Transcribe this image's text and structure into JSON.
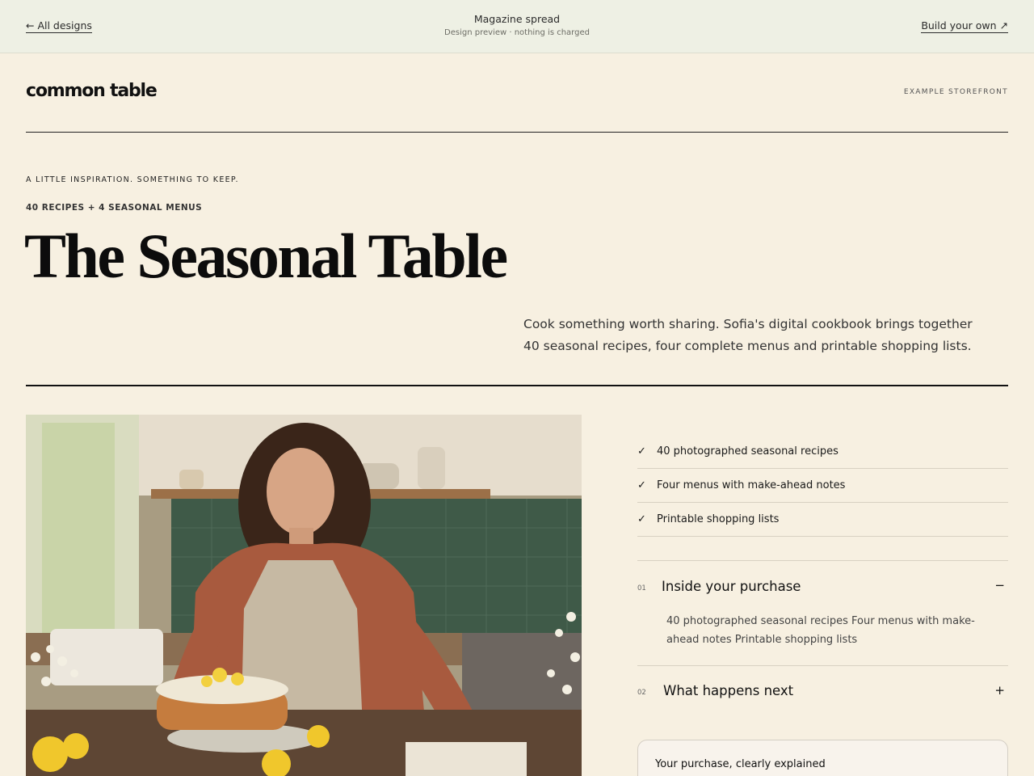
{
  "topbar": {
    "back_label": "← All designs",
    "title": "Magazine spread",
    "subtitle": "Design preview · nothing is charged",
    "build_label": "Build your own ↗"
  },
  "brand": {
    "name": "common table",
    "storefront_label": "EXAMPLE STOREFRONT"
  },
  "hero_text": {
    "kicker": "A LITTLE INSPIRATION. SOMETHING TO KEEP.",
    "sub_kicker": "40 RECIPES + 4 SEASONAL MENUS",
    "title": "The Seasonal Table",
    "lede": "Cook something worth sharing. Sofia's digital cookbook brings together 40 seasonal recipes, four complete menus and printable shopping lists."
  },
  "features": [
    {
      "icon": "check-icon",
      "label": "40 photographed seasonal recipes"
    },
    {
      "icon": "check-icon",
      "label": "Four menus with make-ahead notes"
    },
    {
      "icon": "check-icon",
      "label": "Printable shopping lists"
    }
  ],
  "accordion": [
    {
      "number": "01",
      "title": "Inside your purchase",
      "toggle": "−",
      "expanded": true,
      "body": "40 photographed seasonal recipes Four menus with make-ahead notes Printable shopping lists"
    },
    {
      "number": "02",
      "title": "What happens next",
      "toggle": "+",
      "expanded": false
    }
  ],
  "purchase_card": {
    "label": "Your purchase, clearly explained"
  },
  "colors": {
    "page_bg": "#f7f0e1",
    "topbar_bg": "#eef0e4",
    "ink": "#111111",
    "rule": "#d8d1c2"
  }
}
